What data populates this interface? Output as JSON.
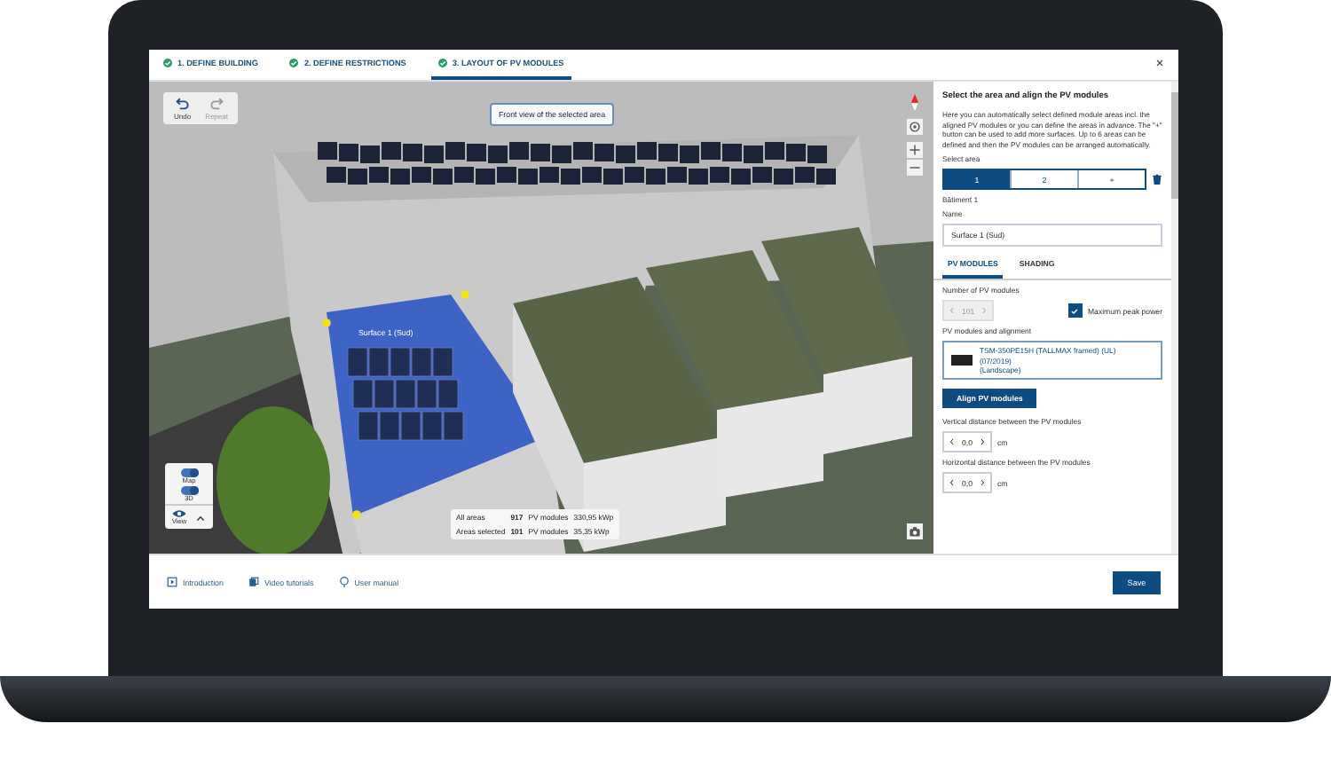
{
  "tabs": [
    {
      "label": "1. DEFINE BUILDING",
      "completed": true,
      "selected": false
    },
    {
      "label": "2. DEFINE RESTRICTIONS",
      "completed": true,
      "selected": false
    },
    {
      "label": "3. LAYOUT OF PV MODULES",
      "completed": true,
      "selected": true
    }
  ],
  "viewport": {
    "undo": {
      "label": "Undo",
      "disabled": false
    },
    "repeat": {
      "label": "Repeat",
      "disabled": true
    },
    "front_view_button": "Front view of the selected area",
    "surface_label": "Surface 1 (Sud)",
    "toggles": [
      {
        "label": "Map",
        "on": true
      },
      {
        "label": "3D",
        "on": true
      }
    ],
    "view_label": "View",
    "summary": [
      {
        "label": "All areas",
        "count": "917",
        "unit": "PV modules",
        "power": "330,95 kWp"
      },
      {
        "label": "Areas selected",
        "count": "101",
        "unit": "PV modules",
        "power": "35,35 kWp"
      }
    ]
  },
  "panel": {
    "title": "Select the area and align the PV modules",
    "description": "Here you can automatically select defined module areas incl. the aligned PV modules or you can define the areas in advance. The \"+\" button can be used to add more surfaces. Up to 6 areas can be defined and then the PV modules can be arranged automatically.",
    "select_area_label": "Select area",
    "areas": [
      {
        "label": "1",
        "selected": true
      },
      {
        "label": "2",
        "selected": false
      },
      {
        "label": "+",
        "selected": false
      }
    ],
    "building": "Bâtiment 1",
    "name_label": "Name",
    "name_value": "Surface 1 (Sud)",
    "subtabs": [
      {
        "label": "PV MODULES",
        "selected": true
      },
      {
        "label": "SHADING",
        "selected": false
      }
    ],
    "number_label": "Number of PV modules",
    "number_value": "101",
    "number_disabled": true,
    "max_peak": {
      "label": "Maximum peak power",
      "checked": true
    },
    "modules_label": "PV modules and alignment",
    "module_lines": [
      "TSM-350PE15H (TALLMAX framed) (UL)",
      "(07/2019)",
      "(Landscape)"
    ],
    "align_button": "Align PV modules",
    "distances": [
      {
        "label": "Vertical distance between the PV modules",
        "value": "0,0",
        "unit": "cm"
      },
      {
        "label": "Horizontal distance between the PV modules",
        "value": "0,0",
        "unit": "cm"
      }
    ]
  },
  "footer": {
    "links": [
      {
        "kind": "intro",
        "label": "Introduction"
      },
      {
        "kind": "video",
        "label": "Video tutorials"
      },
      {
        "kind": "manual",
        "label": "User manual"
      }
    ],
    "save": "Save"
  }
}
